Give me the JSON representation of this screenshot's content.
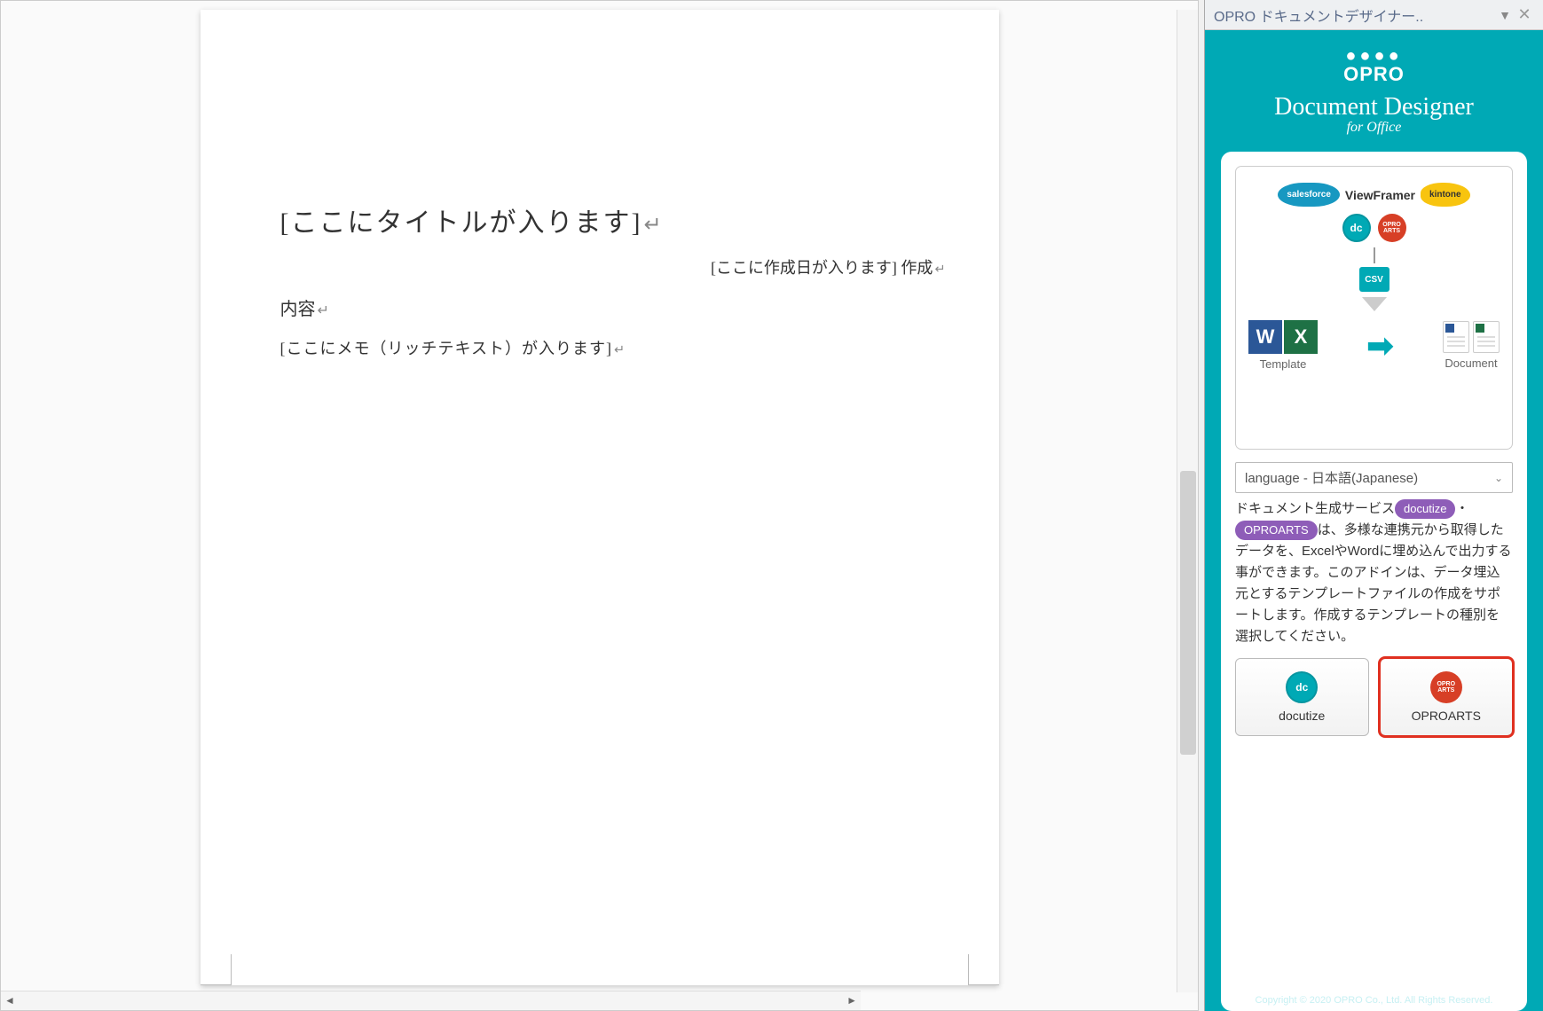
{
  "document": {
    "title_placeholder": "[ここにタイトルが入ります]",
    "date_placeholder": "[ここに作成日が入ります] 作成",
    "content_label": "内容",
    "memo_placeholder": "[ここにメモ（リッチテキスト）が入ります]"
  },
  "pane": {
    "header_title": "OPRO ドキュメントデザイナー..",
    "logo": {
      "brand": "OPRO",
      "title": "Document Designer",
      "subtitle": "for Office"
    },
    "diagram": {
      "salesforce": "salesforce",
      "viewframer": "ViewFramer",
      "kintone": "kintone",
      "dc": "dc",
      "oproarts": "OPRO ARTS",
      "csv": "CSV",
      "template_label": "Template",
      "document_label": "Document"
    },
    "language_selected": "language - 日本語(Japanese)",
    "description_pre": "ドキュメント生成サービス",
    "badge_docutize": "docutize",
    "description_mid": "・",
    "badge_oproarts": "OPROARTS",
    "description_post": "は、多様な連携元から取得したデータを、ExcelやWordに埋め込んで出力する事ができます。このアドインは、データ埋込元とするテンプレートファイルの作成をサポートします。作成するテンプレートの種別を選択してください。",
    "button_docutize": "docutize",
    "button_oproarts": "OPROARTS",
    "copyright": "Copyright © 2020 OPRO Co., Ltd. All Rights Reserved."
  }
}
